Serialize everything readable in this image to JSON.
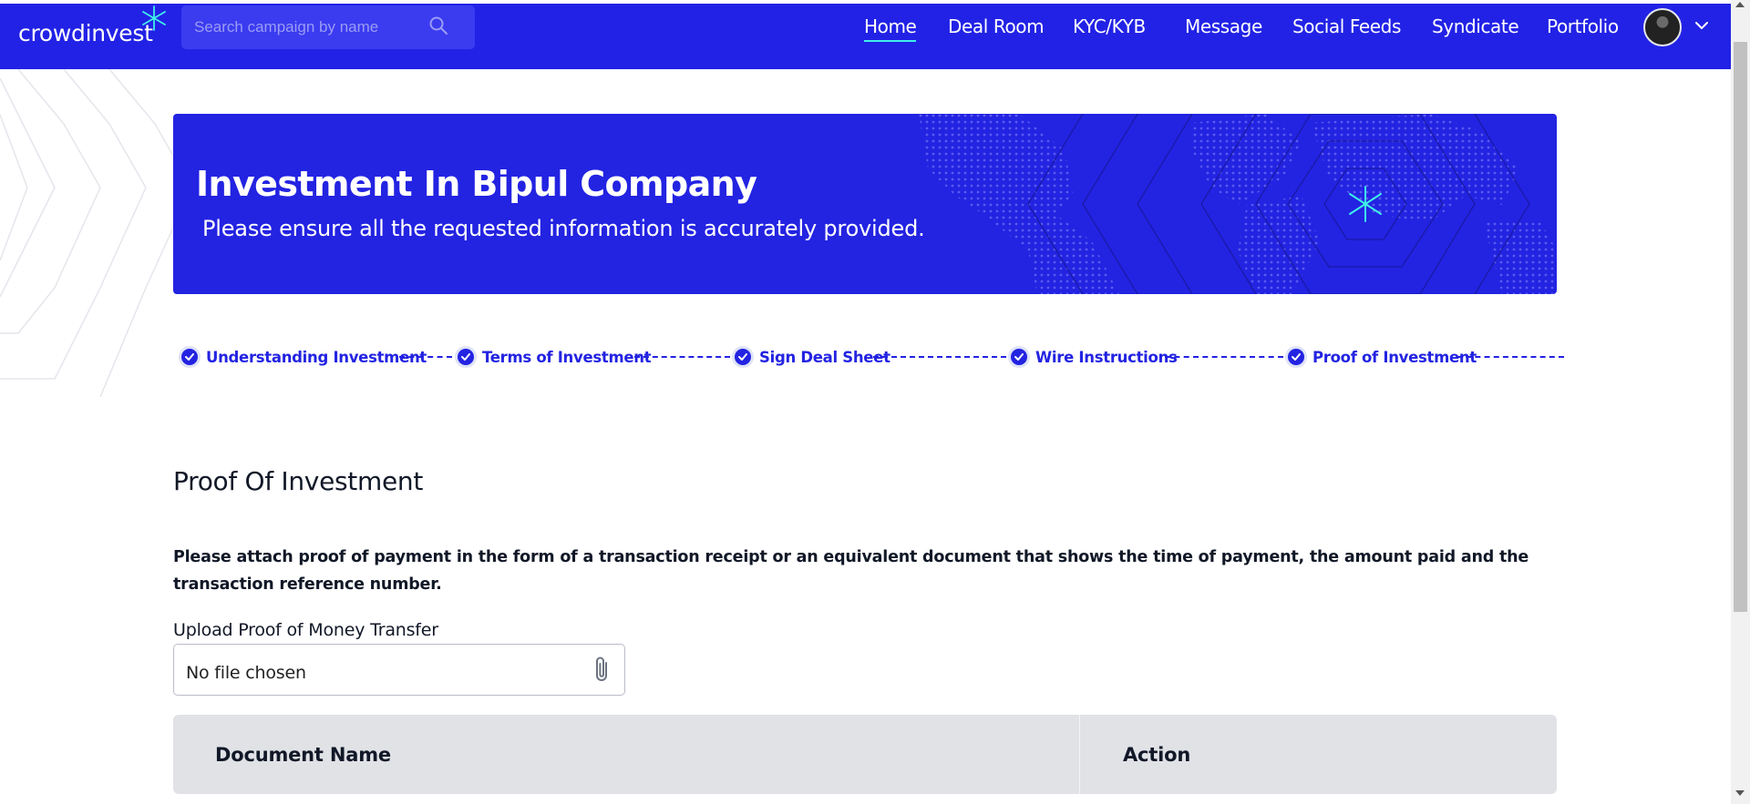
{
  "navbar": {
    "brand": "crowdinvest",
    "search_placeholder": "Search campaign by name",
    "items": [
      {
        "label": "Home",
        "active": true
      },
      {
        "label": "Deal Room"
      },
      {
        "label": "KYC/KYB"
      },
      {
        "label": "Message"
      },
      {
        "label": "Social Feeds"
      },
      {
        "label": "Syndicate"
      },
      {
        "label": "Portfolio"
      }
    ],
    "icons": {
      "search": "search-icon",
      "avatar": "avatar",
      "caret": "chevron-down-icon"
    }
  },
  "banner": {
    "title": "Investment In Bipul Company",
    "subtitle": "Please ensure all the requested information is accurately provided."
  },
  "stepper": {
    "steps": [
      {
        "label": "Understanding Investment",
        "completed": true
      },
      {
        "label": "Terms of Investment",
        "completed": true
      },
      {
        "label": "Sign Deal Sheet",
        "completed": true
      },
      {
        "label": "Wire Instructions",
        "completed": true
      },
      {
        "label": "Proof of Investment",
        "completed": true
      }
    ]
  },
  "section": {
    "title": "Proof Of Investment",
    "instructions": "Please attach proof of payment in the form of a transaction receipt or an equivalent document that shows the time of payment, the amount paid and the transaction reference number.",
    "upload_label": "Upload Proof of Money Transfer",
    "file_status": "No file chosen"
  },
  "table": {
    "columns": [
      "Document Name",
      "Action"
    ]
  },
  "colors": {
    "primary": "#2323e2",
    "accent": "#3ff0e8",
    "table_header": "#e0e2e6"
  }
}
